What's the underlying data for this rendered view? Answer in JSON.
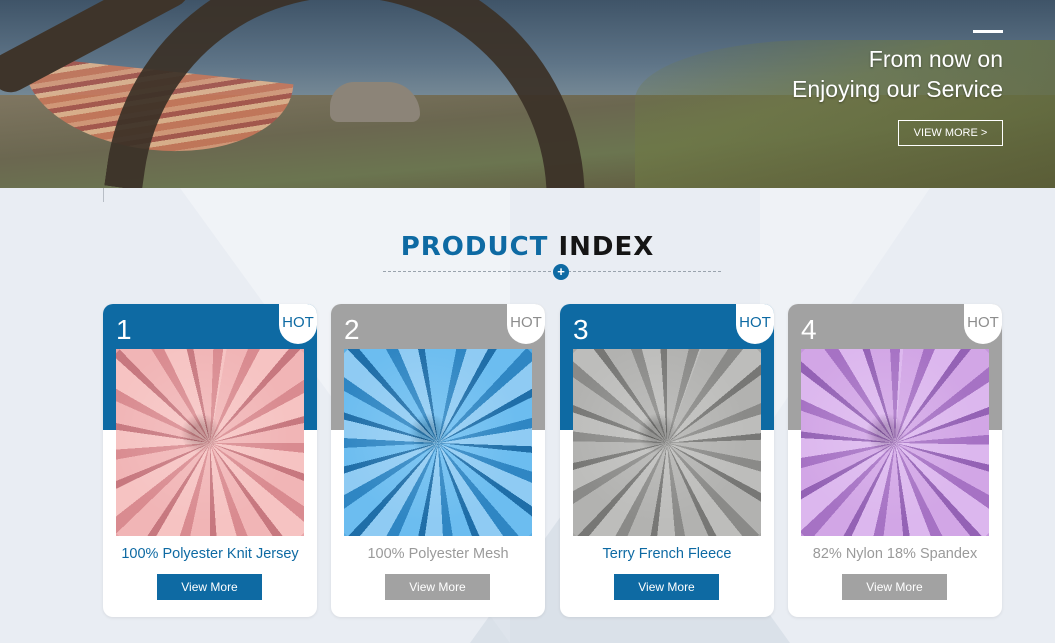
{
  "hero": {
    "title_line1": "From now on",
    "title_line2": "Enjoying our Service",
    "button_label": "VIEW MORE >"
  },
  "section": {
    "title_part1": "PRODUCT",
    "title_part2": "INDEX",
    "plus_symbol": "+"
  },
  "colors": {
    "accent": "#0e6aa3",
    "muted": "#a2a2a2"
  },
  "products": [
    {
      "number": "1",
      "badge": "HOT",
      "name": "100% Polyester Knit Jersey",
      "button": "View More",
      "style": "blue",
      "fabric": "pink"
    },
    {
      "number": "2",
      "badge": "HOT",
      "name": "100% Polyester Mesh",
      "button": "View More",
      "style": "grey",
      "fabric": "blue"
    },
    {
      "number": "3",
      "badge": "HOT",
      "name": "Terry French Fleece",
      "button": "View More",
      "style": "blue",
      "fabric": "grey"
    },
    {
      "number": "4",
      "badge": "HOT",
      "name": "82% Nylon 18% Spandex",
      "button": "View More",
      "style": "grey",
      "fabric": "lilac"
    }
  ]
}
